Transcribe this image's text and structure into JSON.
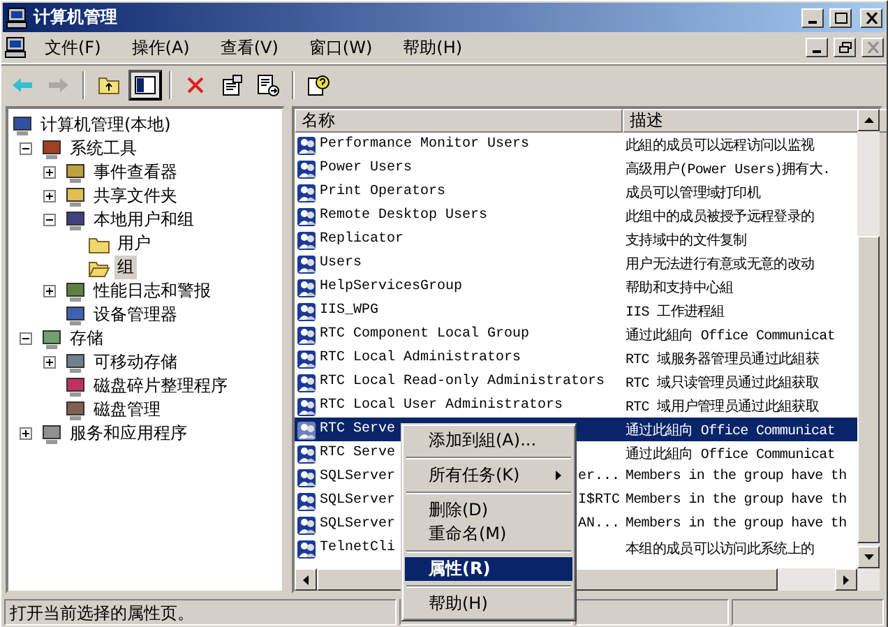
{
  "window": {
    "title": "计算机管理"
  },
  "menu": [
    "文件(F)",
    "操作(A)",
    "查看(V)",
    "窗口(W)",
    "帮助(H)"
  ],
  "toolbar": [
    {
      "kind": "back",
      "disabled": false
    },
    {
      "kind": "forward",
      "disabled": true
    },
    {
      "kind": "sep"
    },
    {
      "kind": "up",
      "disabled": false
    },
    {
      "kind": "tree",
      "disabled": false,
      "pressed": true
    },
    {
      "kind": "sep"
    },
    {
      "kind": "delete",
      "disabled": false
    },
    {
      "kind": "properties",
      "disabled": false
    },
    {
      "kind": "export",
      "disabled": false
    },
    {
      "kind": "sep"
    },
    {
      "kind": "help",
      "disabled": false
    }
  ],
  "tree": [
    {
      "label": "计算机管理(本地)",
      "kind": "computer",
      "selected": false,
      "children": [
        {
          "label": "系统工具",
          "kind": "tools",
          "expanded": true,
          "selected": false,
          "children": [
            {
              "label": "事件查看器",
              "kind": "event",
              "expanded": false,
              "selected": false
            },
            {
              "label": "共享文件夹",
              "kind": "share",
              "expanded": false,
              "selected": false
            },
            {
              "label": "本地用户和组",
              "kind": "users",
              "expanded": true,
              "selected": false,
              "children": [
                {
                  "label": "用户",
                  "kind": "folder",
                  "selected": false
                },
                {
                  "label": "组",
                  "kind": "openfolder",
                  "selected": true
                }
              ]
            },
            {
              "label": "性能日志和警报",
              "kind": "perf",
              "expanded": false,
              "selected": false
            },
            {
              "label": "设备管理器",
              "kind": "device",
              "selected": false
            }
          ]
        },
        {
          "label": "存储",
          "kind": "storage",
          "expanded": true,
          "selected": false,
          "children": [
            {
              "label": "可移动存储",
              "kind": "removable",
              "expanded": false,
              "selected": false
            },
            {
              "label": "磁盘碎片整理程序",
              "kind": "defrag",
              "selected": false
            },
            {
              "label": "磁盘管理",
              "kind": "disk",
              "selected": false
            }
          ]
        },
        {
          "label": "服务和应用程序",
          "kind": "services",
          "expanded": false,
          "selected": false
        }
      ]
    }
  ],
  "list": {
    "columns": [
      "名称",
      "描述"
    ],
    "rows": [
      {
        "name": "Performance Monitor Users",
        "description": "此組的成员可以远程访问以监视",
        "selected": false
      },
      {
        "name": "Power Users",
        "description": "高级用户(Power Users)拥有大.",
        "selected": false
      },
      {
        "name": "Print Operators",
        "description": "成员可以管理域打印机",
        "selected": false
      },
      {
        "name": "Remote Desktop Users",
        "description": "此组中的成员被授予远程登录的",
        "selected": false
      },
      {
        "name": "Replicator",
        "description": "支持域中的文件复制",
        "selected": false
      },
      {
        "name": "Users",
        "description": "用户无法进行有意或无意的改动",
        "selected": false
      },
      {
        "name": "HelpServicesGroup",
        "description": "帮助和支持中心組",
        "selected": false
      },
      {
        "name": "IIS_WPG",
        "description": "IIS 工作进程組",
        "selected": false
      },
      {
        "name": "RTC Component Local Group",
        "description": "通过此組向 Office Communicat",
        "selected": false
      },
      {
        "name": "RTC Local Administrators",
        "description": "RTC 域服务器管理员通过此組获",
        "selected": false
      },
      {
        "name": "RTC Local Read-only Administrators",
        "description": "RTC 域只读管理员通过此組获取",
        "selected": false
      },
      {
        "name": "RTC Local User Administrators",
        "description": "RTC 域用户管理员通过此組获取",
        "selected": false
      },
      {
        "name": "RTC Serve",
        "description": "通过此組向 Office Communicat",
        "selected": true
      },
      {
        "name": "RTC Serve",
        "description": "通过此組向 Office Communicat",
        "selected": false
      },
      {
        "name": "SQLServer",
        "name_tail": "er...",
        "description": "Members in the group have th",
        "selected": false
      },
      {
        "name": "SQLServer",
        "name_tail": "I$RTC",
        "description": "Members in the group have th",
        "selected": false
      },
      {
        "name": "SQLServer",
        "name_tail": "AN...",
        "description": "Members in the group have th",
        "selected": false
      },
      {
        "name": "TelnetCli",
        "description": "本组的成员可以访问此系统上的",
        "selected": false
      }
    ]
  },
  "context_menu": [
    {
      "kind": "item",
      "label": "添加到組(A)...",
      "selected": false
    },
    {
      "kind": "separator"
    },
    {
      "kind": "item",
      "label": "所有任务(K)",
      "submenu": true,
      "selected": false
    },
    {
      "kind": "separator"
    },
    {
      "kind": "item",
      "label": "删除(D)",
      "selected": false
    },
    {
      "kind": "item",
      "label": "重命名(M)",
      "selected": false
    },
    {
      "kind": "separator"
    },
    {
      "kind": "item",
      "label": "属性(R)",
      "selected": true
    },
    {
      "kind": "separator"
    },
    {
      "kind": "item",
      "label": "帮助(H)",
      "selected": false
    }
  ],
  "status_bar": {
    "text": "打开当前选择的属性页。"
  }
}
